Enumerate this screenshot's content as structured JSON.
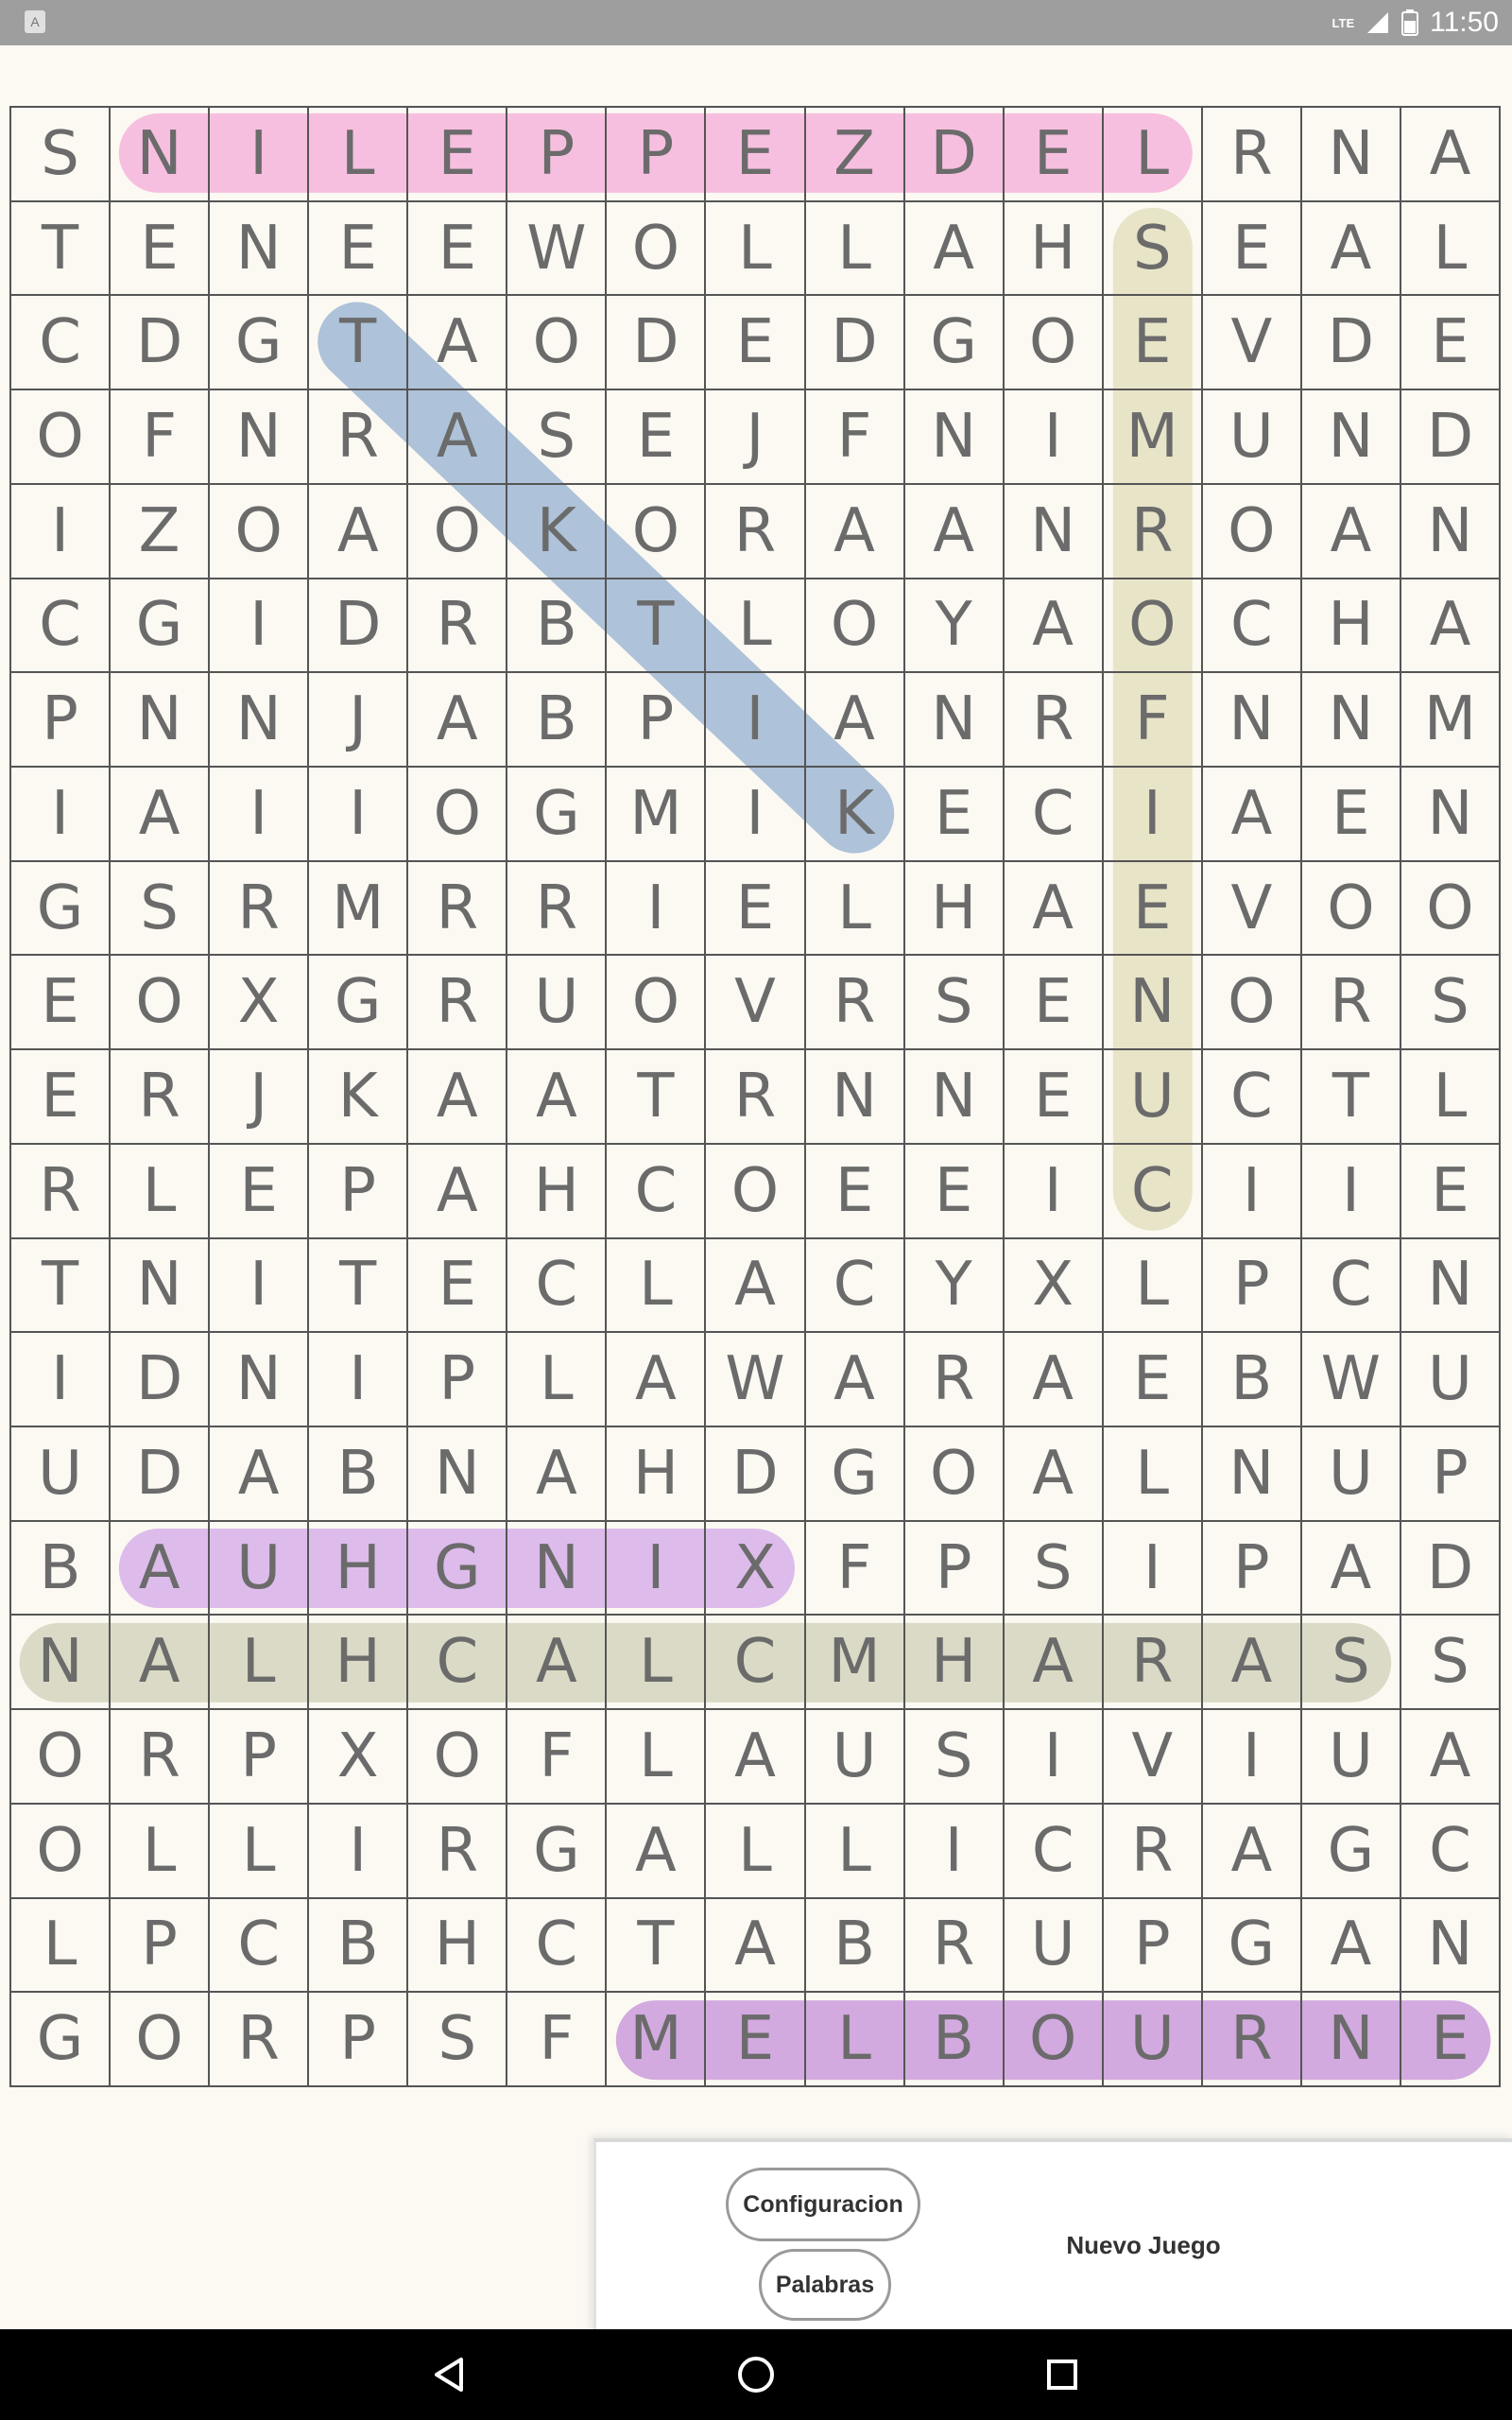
{
  "status_bar": {
    "time": "11:50",
    "network": "LTE",
    "app_icon": "A"
  },
  "grid": {
    "rows": [
      "SNILEPPEZDELRNA",
      "TENEEWOLLAHSEAL",
      "CDGTAODEDGOEVDE",
      "OFNRASEJFNIMUND",
      "IZOAOKORAANROAN",
      "CGIDRBTLOYAOCHA",
      "PNNJABPIANRFNNM",
      "IAIIOGMIKECIAEN",
      "GSRMRRIELHAEVOO",
      "EOXGRUOVRSENORS",
      "ERJKAATRNNEUCTL",
      "RLEPAHCOEEICIIE",
      "TNITECLACYXLPCN",
      "IDNIPLAWARAEBWU",
      "UDABNAHDGOALNUP",
      "BAUHGNIXFPSIPAD",
      "NALHCALCMHARASS",
      "ORPXOFLAUSIVIUA",
      "OLLIRGALLICRAGC",
      "LPCBHCTABRUPGAN",
      "GORPSFMELBOURNE"
    ],
    "found_words": [
      {
        "word": "LEDZEPPELIN",
        "color": "#f48fcf",
        "start": [
          0,
          11
        ],
        "end": [
          0,
          1
        ]
      },
      {
        "word": "TAKTIK",
        "color": "#6f96c4",
        "start": [
          2,
          3
        ],
        "end": [
          7,
          8
        ]
      },
      {
        "word": "SEMROFIENUC",
        "color": "#d8d3a6",
        "start": [
          1,
          11
        ],
        "end": [
          11,
          11
        ]
      },
      {
        "word": "AUHGNIX",
        "color": "#c58be8",
        "start": [
          15,
          1
        ],
        "end": [
          15,
          7
        ]
      },
      {
        "word": "NALHCALCMHARAS",
        "color": "#bfc1a3",
        "start": [
          16,
          0
        ],
        "end": [
          16,
          13
        ]
      },
      {
        "word": "MELBOURNE",
        "color": "#b06ad0",
        "start": [
          20,
          6
        ],
        "end": [
          20,
          14
        ]
      }
    ]
  },
  "controls": {
    "config_label": "Configuracion",
    "words_label": "Palabras",
    "new_game_label": "Nuevo Juego"
  },
  "nav": {
    "back_icon": "back-triangle-icon",
    "home_icon": "home-circle-icon",
    "recents_icon": "recents-square-icon"
  }
}
